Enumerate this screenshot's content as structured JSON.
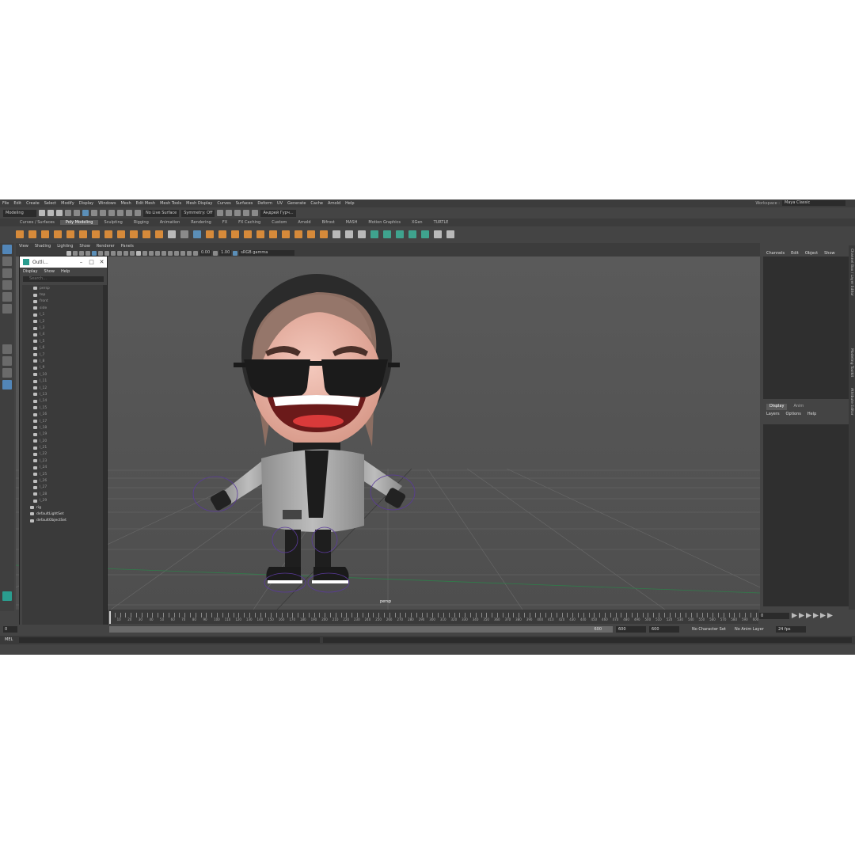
{
  "menu": [
    "File",
    "Edit",
    "Create",
    "Select",
    "Modify",
    "Display",
    "Windows",
    "Mesh",
    "Edit Mesh",
    "Mesh Tools",
    "Mesh Display",
    "Curves",
    "Surfaces",
    "Deform",
    "UV",
    "Generate",
    "Cache",
    "Arnold",
    "Help"
  ],
  "workspace": {
    "label": "Workspace :",
    "value": "Maya Classic"
  },
  "status": {
    "mode": "Modeling",
    "live_surface": "No Live Surface",
    "symmetry": "Symmetry: Off",
    "user": "Андрей Гурч..."
  },
  "shelf_tabs": [
    "Curves / Surfaces",
    "Poly Modeling",
    "Sculpting",
    "Rigging",
    "Animation",
    "Rendering",
    "FX",
    "FX Caching",
    "Custom",
    "Arnold",
    "Bifrost",
    "MASH",
    "Motion Graphics",
    "XGen",
    "TURTLE"
  ],
  "shelf_active": "Poly Modeling",
  "viewport": {
    "menu": [
      "View",
      "Shading",
      "Lighting",
      "Show",
      "Renderer",
      "Panels"
    ],
    "exposure": "0.00",
    "gamma": "1.00",
    "colorspace": "sRGB gamma",
    "camera": "persp"
  },
  "outliner": {
    "title": "Outli...",
    "menu": [
      "Display",
      "Show",
      "Help"
    ],
    "search_placeholder": "Search...",
    "rows": [
      "persp",
      "top",
      "front",
      "side",
      "l_1",
      "l_2",
      "l_3",
      "l_4",
      "l_5",
      "l_6",
      "l_7",
      "l_8",
      "l_9",
      "l_10",
      "l_11",
      "l_12",
      "l_13",
      "l_14",
      "l_15",
      "l_16",
      "l_17",
      "l_18",
      "l_19",
      "l_20",
      "l_21",
      "l_22",
      "l_23",
      "l_24",
      "l_25",
      "l_26",
      "l_27",
      "l_28",
      "l_29",
      "rig",
      "defaultLightSet",
      "defaultObjectSet"
    ]
  },
  "channel_box": {
    "menu": [
      "Channels",
      "Edit",
      "Object",
      "Show"
    ]
  },
  "layer_editor": {
    "tabs": [
      "Display",
      "Anim"
    ],
    "menu": [
      "Layers",
      "Options",
      "Help"
    ]
  },
  "side_tabs": [
    "Channel Box / Layer Editor",
    "Modeling Toolkit",
    "Attribute Editor"
  ],
  "timeline": {
    "ticks": [
      "5",
      "10",
      "15",
      "20",
      "25",
      "30",
      "35",
      "40",
      "45",
      "50",
      "55",
      "60",
      "65",
      "70",
      "75",
      "80",
      "85",
      "90",
      "95",
      "100",
      "105",
      "110",
      "115",
      "120",
      "125",
      "130",
      "135",
      "140",
      "145",
      "150",
      "155",
      "160",
      "165",
      "170",
      "175",
      "180",
      "185",
      "190",
      "195",
      "200",
      "205",
      "210",
      "215",
      "220",
      "225",
      "230",
      "235",
      "240",
      "245",
      "250",
      "255",
      "260",
      "265",
      "270",
      "275",
      "280",
      "285",
      "290",
      "295",
      "300",
      "305",
      "310",
      "315",
      "320",
      "325",
      "330",
      "335",
      "340",
      "345",
      "350",
      "355",
      "360",
      "365",
      "370",
      "375",
      "380",
      "385",
      "390",
      "395",
      "400",
      "405",
      "410",
      "415",
      "420",
      "425",
      "430",
      "435",
      "440",
      "445",
      "450",
      "455",
      "460",
      "465",
      "470",
      "475",
      "480",
      "485",
      "490",
      "495",
      "500",
      "505",
      "510",
      "515",
      "520",
      "525",
      "530",
      "535",
      "540",
      "545",
      "550",
      "555",
      "560",
      "565",
      "570",
      "575",
      "580",
      "585",
      "590",
      "595",
      "600"
    ],
    "current_frame": "0"
  },
  "range": {
    "start": "0",
    "range_end": "600",
    "end1": "600",
    "end2": "600",
    "character_set": "No Character Set",
    "anim_layer": "No Anim Layer",
    "fps": "24 fps"
  },
  "command": {
    "label": "MEL"
  }
}
